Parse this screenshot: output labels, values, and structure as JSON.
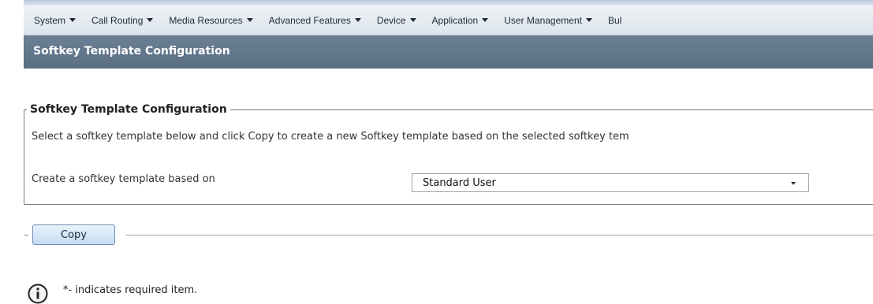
{
  "menubar": {
    "items": [
      {
        "label": "System",
        "icon": "chevron-down-icon"
      },
      {
        "label": "Call Routing",
        "icon": "chevron-down-icon"
      },
      {
        "label": "Media Resources",
        "icon": "chevron-down-icon"
      },
      {
        "label": "Advanced Features",
        "icon": "chevron-down-icon"
      },
      {
        "label": "Device",
        "icon": "chevron-down-icon"
      },
      {
        "label": "Application",
        "icon": "chevron-down-icon"
      },
      {
        "label": "User Management",
        "icon": "chevron-down-icon"
      },
      {
        "label": "Bul"
      }
    ]
  },
  "header": {
    "title": "Softkey Template Configuration"
  },
  "section": {
    "legend": "Softkey Template Configuration",
    "description": "Select a softkey template below and click Copy to create a new Softkey template based on the selected softkey tem",
    "field_label": "Create a softkey template based on",
    "select_value": "Standard User"
  },
  "actions": {
    "copy_label": "Copy"
  },
  "info": {
    "icon": "info-icon",
    "text": "*- indicates required item."
  },
  "colors": {
    "title_bar": "#5f7389",
    "menu_bar": "#e6ebf1",
    "button_fill": "#d6e6f6",
    "border": "#7a7a7a"
  }
}
